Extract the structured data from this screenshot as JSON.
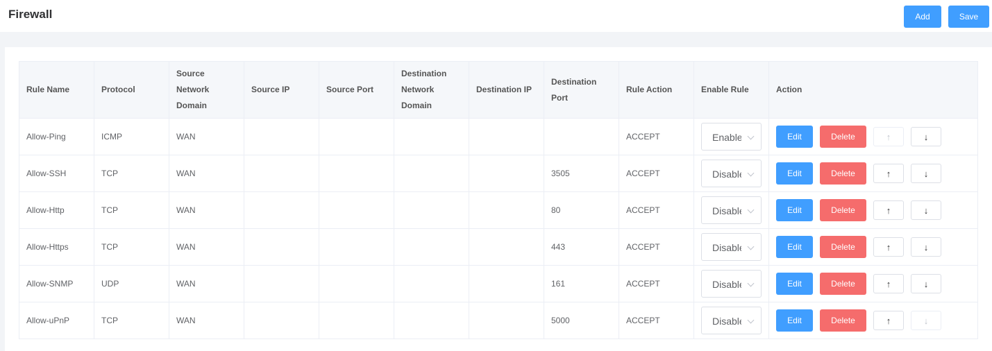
{
  "header": {
    "title": "Firewall",
    "add_label": "Add",
    "save_label": "Save"
  },
  "table": {
    "columns": [
      "Rule Name",
      "Protocol",
      "Source Network Domain",
      "Source IP",
      "Source Port",
      "Destination Network Domain",
      "Destination IP",
      "Destination Port",
      "Rule Action",
      "Enable Rule",
      "Action"
    ],
    "rows": [
      {
        "name": "Allow-Ping",
        "protocol": "ICMP",
        "src_domain": "WAN",
        "src_ip": "",
        "src_port": "",
        "dst_domain": "",
        "dst_ip": "",
        "dst_port": "",
        "action": "ACCEPT",
        "enable": "Enable",
        "up_disabled": true,
        "down_disabled": false
      },
      {
        "name": "Allow-SSH",
        "protocol": "TCP",
        "src_domain": "WAN",
        "src_ip": "",
        "src_port": "",
        "dst_domain": "",
        "dst_ip": "",
        "dst_port": "3505",
        "action": "ACCEPT",
        "enable": "Disable",
        "up_disabled": false,
        "down_disabled": false
      },
      {
        "name": "Allow-Http",
        "protocol": "TCP",
        "src_domain": "WAN",
        "src_ip": "",
        "src_port": "",
        "dst_domain": "",
        "dst_ip": "",
        "dst_port": "80",
        "action": "ACCEPT",
        "enable": "Disable",
        "up_disabled": false,
        "down_disabled": false
      },
      {
        "name": "Allow-Https",
        "protocol": "TCP",
        "src_domain": "WAN",
        "src_ip": "",
        "src_port": "",
        "dst_domain": "",
        "dst_ip": "",
        "dst_port": "443",
        "action": "ACCEPT",
        "enable": "Disable",
        "up_disabled": false,
        "down_disabled": false
      },
      {
        "name": "Allow-SNMP",
        "protocol": "UDP",
        "src_domain": "WAN",
        "src_ip": "",
        "src_port": "",
        "dst_domain": "",
        "dst_ip": "",
        "dst_port": "161",
        "action": "ACCEPT",
        "enable": "Disable",
        "up_disabled": false,
        "down_disabled": false
      },
      {
        "name": "Allow-uPnP",
        "protocol": "TCP",
        "src_domain": "WAN",
        "src_ip": "",
        "src_port": "",
        "dst_domain": "",
        "dst_ip": "",
        "dst_port": "5000",
        "action": "ACCEPT",
        "enable": "Disable",
        "up_disabled": false,
        "down_disabled": true
      }
    ],
    "edit_label": "Edit",
    "delete_label": "Delete",
    "up_icon": "arrow-up-icon",
    "down_icon": "arrow-down-icon"
  },
  "colors": {
    "primary": "#409eff",
    "danger": "#f56c6c"
  }
}
